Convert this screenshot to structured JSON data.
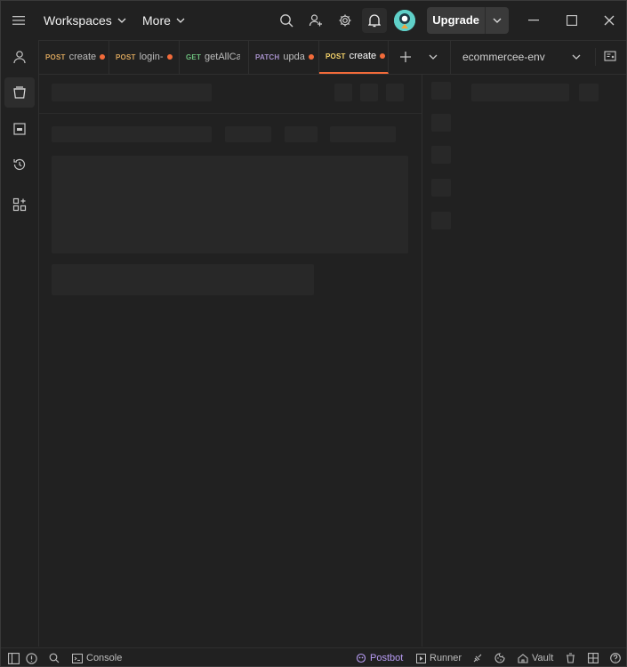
{
  "header": {
    "workspaces_label": "Workspaces",
    "more_label": "More",
    "upgrade_label": "Upgrade",
    "icons": [
      "menu-icon",
      "search-icon",
      "invite-user-icon",
      "settings-icon",
      "bell-icon",
      "avatar",
      "minimize-icon",
      "maximize-icon",
      "close-icon"
    ]
  },
  "tabs": [
    {
      "method": "POST",
      "name": "create",
      "unsaved": true,
      "active": false,
      "method_color": "#d7a35b"
    },
    {
      "method": "POST",
      "name": "login-",
      "unsaved": true,
      "active": false,
      "method_color": "#d7a35b"
    },
    {
      "method": "GET",
      "name": "getAllCa",
      "unsaved": false,
      "active": false,
      "method_color": "#6bbd7b"
    },
    {
      "method": "PATCH",
      "name": "upda",
      "unsaved": true,
      "active": false,
      "method_color": "#a690c9"
    },
    {
      "method": "POST",
      "name": "create",
      "unsaved": true,
      "active": true,
      "method_color": "#f6d36a"
    }
  ],
  "environment": {
    "selected": "ecommercee-env"
  },
  "statusbar": {
    "console_label": "Console",
    "postbot_label": "Postbot",
    "runner_label": "Runner",
    "vault_label": "Vault"
  },
  "colors": {
    "accent": "#f26b3a",
    "postbot": "#b89cf4",
    "background": "#212121"
  }
}
